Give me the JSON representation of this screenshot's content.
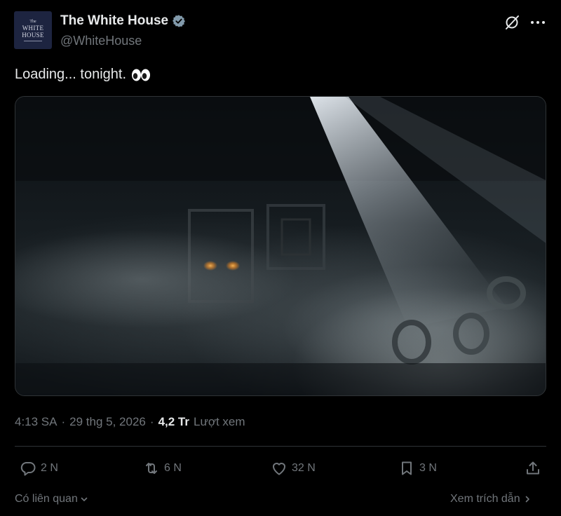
{
  "author": {
    "display_name": "The White House",
    "handle": "@WhiteHouse",
    "avatar_text": [
      "The",
      "WHITE",
      "HOUSE"
    ],
    "verified_color": "#829aab"
  },
  "tweet": {
    "text": "Loading... tonight.",
    "emoji_icon": "eyes-emoji-icon"
  },
  "meta": {
    "time": "4:13 SA",
    "date": "29 thg 5, 2026",
    "separator": "·",
    "views_count": "4,2 Tr",
    "views_label": "Lượt xem"
  },
  "actions": {
    "reply_count": "2 N",
    "retweet_count": "6 N",
    "like_count": "32 N",
    "bookmark_count": "3 N"
  },
  "footer": {
    "related_label": "Có liên quan",
    "quotes_label": "Xem trích dẫn"
  },
  "colors": {
    "background": "#000000",
    "text_primary": "#e7e9ea",
    "text_secondary": "#71767b",
    "border": "#2f3336"
  }
}
